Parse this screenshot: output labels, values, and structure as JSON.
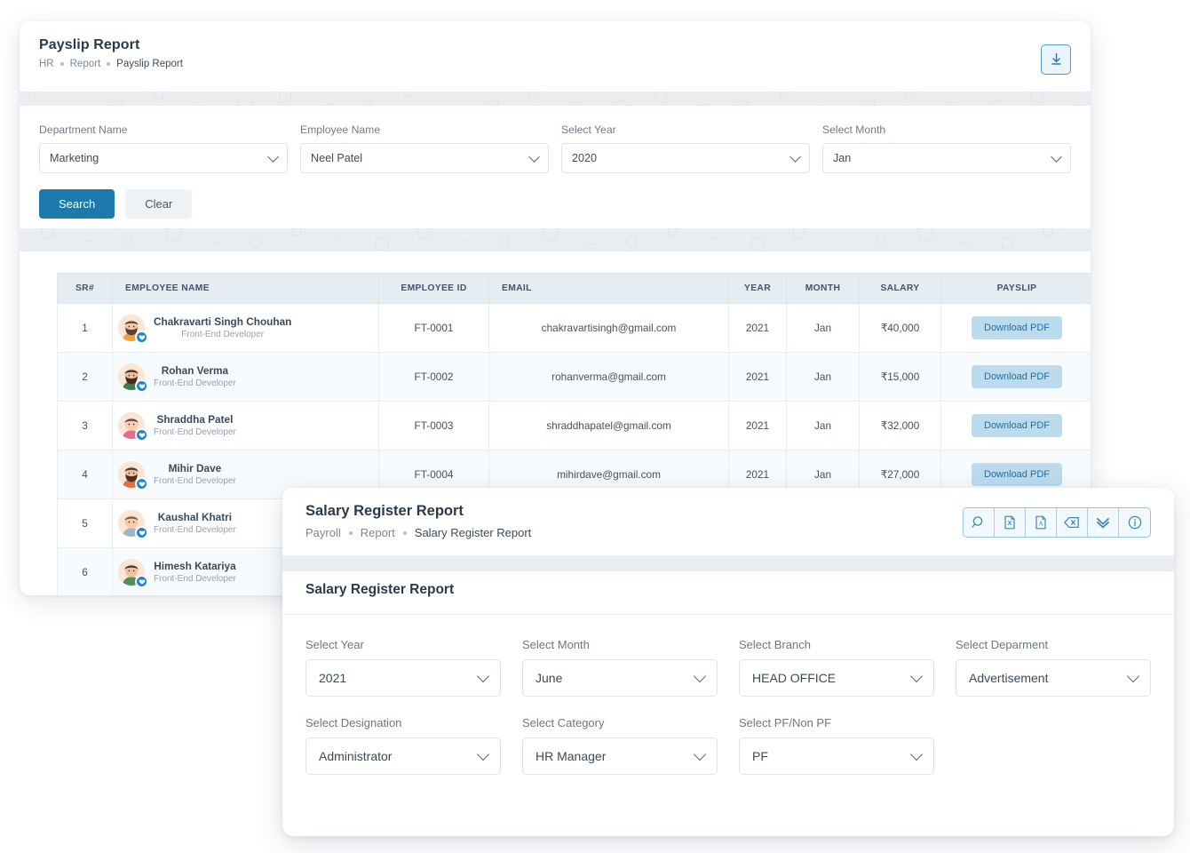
{
  "payslip": {
    "title": "Payslip Report",
    "breadcrumb": [
      "HR",
      "Report",
      "Payslip Report"
    ],
    "download_icon": "download-icon",
    "filters": [
      {
        "label": "Department Name",
        "value": "Marketing"
      },
      {
        "label": "Employee Name",
        "value": "Neel Patel"
      },
      {
        "label": "Select Year",
        "value": "2020"
      },
      {
        "label": "Select Month",
        "value": "Jan"
      }
    ],
    "buttons": {
      "search": "Search",
      "clear": "Clear"
    },
    "table": {
      "columns": [
        "SR#",
        "EMPLOYEE NAME",
        "EMPLOYEE ID",
        "EMAIL",
        "YEAR",
        "MONTH",
        "SALARY",
        "PAYSLIP"
      ],
      "action_label": "Download PDF",
      "rows": [
        {
          "sr": "1",
          "name": "Chakravarti Singh Chouhan",
          "role": "Front-End Developer",
          "id": "FT-0001",
          "email": "chakravartisingh@gmail.com",
          "year": "2021",
          "month": "Jan",
          "salary": "₹40,000"
        },
        {
          "sr": "2",
          "name": "Rohan Verma",
          "role": "Front-End Developer",
          "id": "FT-0002",
          "email": "rohanverma@gmail.com",
          "year": "2021",
          "month": "Jan",
          "salary": "₹15,000"
        },
        {
          "sr": "3",
          "name": "Shraddha Patel",
          "role": "Front-End Developer",
          "id": "FT-0003",
          "email": "shraddhapatel@gmail.com",
          "year": "2021",
          "month": "Jan",
          "salary": "₹32,000"
        },
        {
          "sr": "4",
          "name": "Mihir Dave",
          "role": "Front-End Developer",
          "id": "FT-0004",
          "email": "mihirdave@gmail.com",
          "year": "2021",
          "month": "Jan",
          "salary": "₹27,000"
        },
        {
          "sr": "5",
          "name": "Kaushal Khatri",
          "role": "Front-End Developer",
          "id": "",
          "email": "",
          "year": "",
          "month": "",
          "salary": ""
        },
        {
          "sr": "6",
          "name": "Himesh Katariya",
          "role": "Front-End Developer",
          "id": "",
          "email": "",
          "year": "",
          "month": "",
          "salary": ""
        }
      ]
    }
  },
  "salary_register": {
    "title": "Salary Register Report",
    "breadcrumb": [
      "Payroll",
      "Report",
      "Salary Register Report"
    ],
    "section_title": "Salary Register Report",
    "toolbar": [
      {
        "name": "search-icon"
      },
      {
        "name": "excel-export-icon"
      },
      {
        "name": "pdf-export-icon"
      },
      {
        "name": "clear-icon"
      },
      {
        "name": "chevron-double-down-icon"
      },
      {
        "name": "info-icon"
      }
    ],
    "fields": [
      {
        "label": "Select Year",
        "value": "2021"
      },
      {
        "label": "Select Month",
        "value": "June"
      },
      {
        "label": "Select Branch",
        "value": "HEAD OFFICE"
      },
      {
        "label": "Select Deparment",
        "value": "Advertisement"
      },
      {
        "label": "Select Designation",
        "value": "Administrator"
      },
      {
        "label": "Select Category",
        "value": "HR Manager"
      },
      {
        "label": "Select PF/Non PF",
        "value": "PF"
      }
    ]
  },
  "colors": {
    "accent_blue": "#1b7aab",
    "header_bg": "#e6edf2",
    "chip_bg": "#bcdcee",
    "icon_border": "#93c4de"
  }
}
